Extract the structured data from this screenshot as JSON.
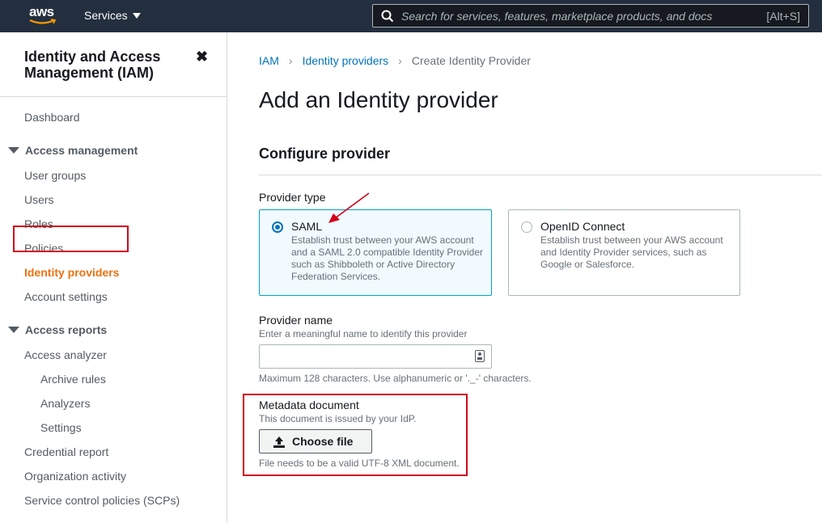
{
  "topnav": {
    "logo_text": "aws",
    "services_label": "Services",
    "search_placeholder": "Search for services, features, marketplace products, and docs",
    "search_shortcut": "[Alt+S]"
  },
  "sidebar": {
    "title": "Identity and Access Management (IAM)",
    "close_glyph": "✖",
    "dashboard": "Dashboard",
    "access_management": {
      "label": "Access management",
      "items": [
        "User groups",
        "Users",
        "Roles",
        "Policies",
        "Identity providers",
        "Account settings"
      ]
    },
    "access_reports": {
      "label": "Access reports",
      "analyzer": "Access analyzer",
      "analyzer_items": [
        "Archive rules",
        "Analyzers",
        "Settings"
      ],
      "items": [
        "Credential report",
        "Organization activity",
        "Service control policies (SCPs)"
      ]
    },
    "active_item": "Identity providers"
  },
  "breadcrumb": {
    "items": [
      "IAM",
      "Identity providers"
    ],
    "current": "Create Identity Provider"
  },
  "page": {
    "title": "Add an Identity provider",
    "section_title": "Configure provider"
  },
  "provider_type": {
    "label": "Provider type",
    "options": [
      {
        "title": "SAML",
        "description": "Establish trust between your AWS account and a SAML 2.0 compatible Identity Provider such as Shibboleth or Active Directory Federation Services.",
        "selected": true
      },
      {
        "title": "OpenID Connect",
        "description": "Establish trust between your AWS account and Identity Provider services, such as Google or Salesforce.",
        "selected": false
      }
    ]
  },
  "provider_name": {
    "label": "Provider name",
    "description": "Enter a meaningful name to identify this provider",
    "value": "",
    "constraint": "Maximum 128 characters. Use alphanumeric or '._-' characters."
  },
  "metadata": {
    "label": "Metadata document",
    "description": "This document is issued by your IdP.",
    "button_label": "Choose file",
    "constraint": "File needs to be a valid UTF-8 XML document."
  },
  "colors": {
    "nav_bg": "#232f3e",
    "link": "#0073bb",
    "active_nav": "#ec7211",
    "annotation": "#d0021b",
    "selected_tile_bg": "#f1faff"
  }
}
